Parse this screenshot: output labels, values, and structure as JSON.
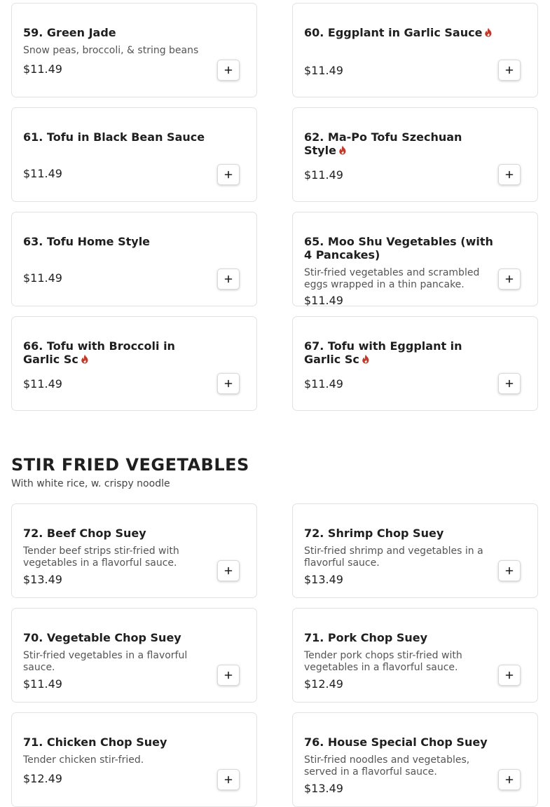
{
  "colors": {
    "spicy": "#c0392b",
    "border": "#e2e2e2"
  },
  "icons": {
    "spicy": "flame-icon",
    "add": "plus-icon"
  },
  "section": {
    "title": "STIR FRIED VEGETABLES",
    "subtitle": "With white rice, w. crispy noodle"
  },
  "items": [
    {
      "name": "59. Green Jade",
      "description": "Snow peas, broccoli, & string beans",
      "price": "$11.49",
      "spicy": false
    },
    {
      "name": "60. Eggplant in Garlic Sauce",
      "description": "",
      "price": "$11.49",
      "spicy": true
    },
    {
      "name": "61. Tofu in Black Bean Sauce",
      "description": "",
      "price": "$11.49",
      "spicy": false
    },
    {
      "name": "62. Ma-Po Tofu Szechuan Style",
      "description": "",
      "price": "$11.49",
      "spicy": true
    },
    {
      "name": "63. Tofu Home Style",
      "description": "",
      "price": "$11.49",
      "spicy": false
    },
    {
      "name": "65. Moo Shu Vegetables (with 4 Pancakes)",
      "description": "Stir-fried vegetables and scrambled eggs wrapped in a thin pancake.",
      "price": "$11.49",
      "spicy": false
    },
    {
      "name": "66. Tofu with Broccoli in Garlic Sc",
      "description": "",
      "price": "$11.49",
      "spicy": true
    },
    {
      "name": "67. Tofu with Eggplant in Garlic Sc",
      "description": "",
      "price": "$11.49",
      "spicy": true
    },
    {
      "name": "72. Beef Chop Suey",
      "description": "Tender beef strips stir-fried with vegetables in a flavorful sauce.",
      "price": "$13.49",
      "spicy": false
    },
    {
      "name": "72. Shrimp Chop Suey",
      "description": "Stir-fried shrimp and vegetables in a flavorful sauce.",
      "price": "$13.49",
      "spicy": false
    },
    {
      "name": "70. Vegetable Chop Suey",
      "description": "Stir-fried vegetables in a flavorful sauce.",
      "price": "$11.49",
      "spicy": false
    },
    {
      "name": "71. Pork Chop Suey",
      "description": "Tender pork chops stir-fried with vegetables in a flavorful sauce.",
      "price": "$12.49",
      "spicy": false
    },
    {
      "name": "71. Chicken Chop Suey",
      "description": "Tender chicken stir-fried.",
      "price": "$12.49",
      "spicy": false
    },
    {
      "name": "76. House Special Chop Suey",
      "description": "Stir-fried noodles and vegetables, served in a flavorful sauce.",
      "price": "$13.49",
      "spicy": false
    }
  ]
}
